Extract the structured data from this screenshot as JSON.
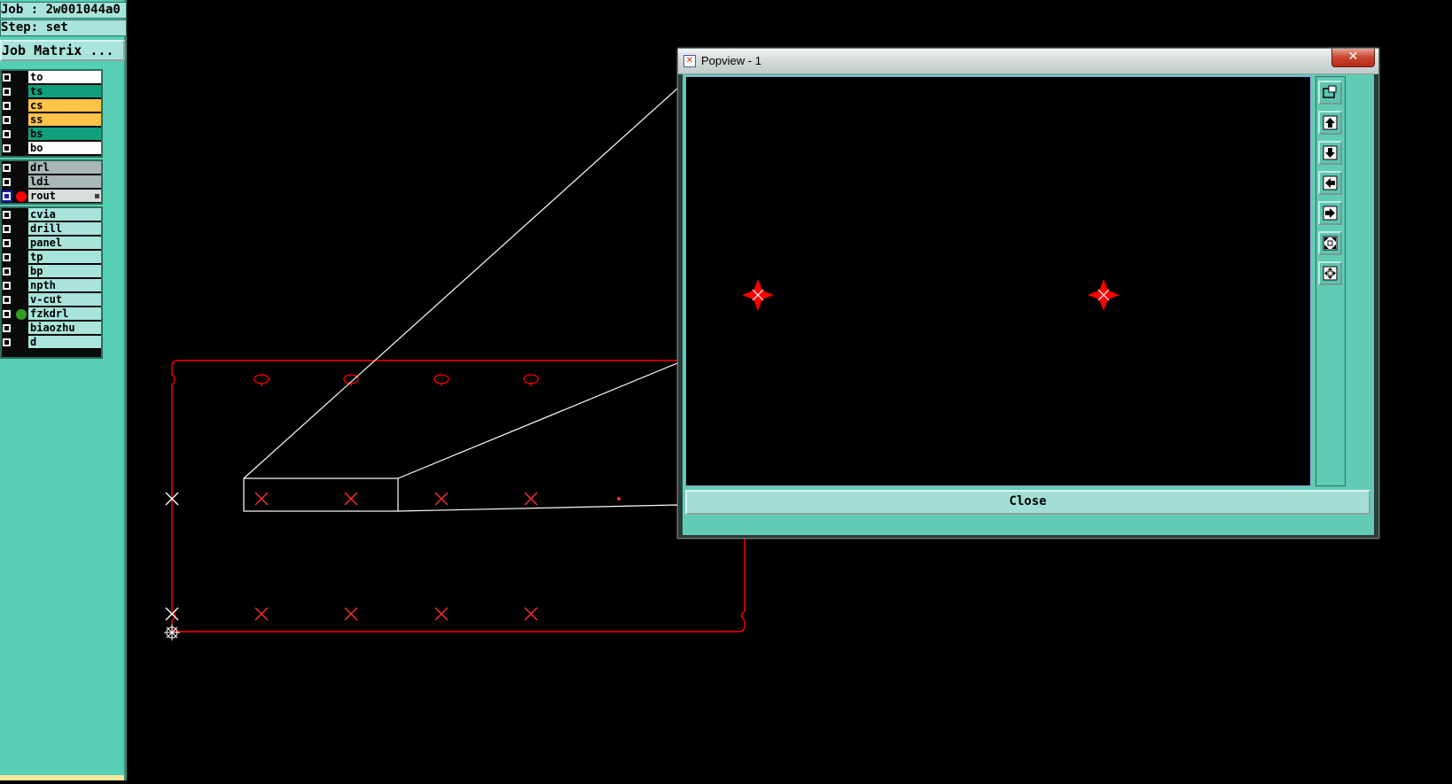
{
  "job": {
    "job_label": "Job : 2w001044a0",
    "step_label": "Step: set",
    "matrix_button": "Job Matrix ..."
  },
  "layers": {
    "group1": [
      {
        "name": "to",
        "color": "#ffffff"
      },
      {
        "name": "ts",
        "color": "#10a07c"
      },
      {
        "name": "cs",
        "color": "#ffc34a"
      },
      {
        "name": "ss",
        "color": "#ffc34a"
      },
      {
        "name": "bs",
        "color": "#10a07c"
      },
      {
        "name": "bo",
        "color": "#ffffff"
      }
    ],
    "group2": [
      {
        "name": "drl",
        "color": "#a9b7b7"
      },
      {
        "name": "ldi",
        "color": "#a9b7b7"
      },
      {
        "name": "rout",
        "color": "#d8dcdc",
        "selected": true,
        "dot": "#ff0000"
      }
    ],
    "group3": [
      {
        "name": "cvia",
        "color": "#a9e4da"
      },
      {
        "name": "drill",
        "color": "#a9e4da"
      },
      {
        "name": "panel",
        "color": "#a9e4da"
      },
      {
        "name": "tp",
        "color": "#a9e4da"
      },
      {
        "name": "bp",
        "color": "#a9e4da"
      },
      {
        "name": "npth",
        "color": "#a9e4da"
      },
      {
        "name": "v-cut",
        "color": "#a9e4da"
      },
      {
        "name": "fzkdrl",
        "color": "#a9e4da",
        "dot": "#30a020"
      },
      {
        "name": "biaozhu",
        "color": "#a9e4da"
      },
      {
        "name": "d",
        "color": "#a9e4da"
      }
    ]
  },
  "popview": {
    "title": "Popview - 1",
    "close_x": "✕",
    "close_button": "Close",
    "tools": [
      "zoom-window-icon",
      "pan-up-icon",
      "pan-down-icon",
      "pan-left-icon",
      "pan-right-icon",
      "zoom-fit-icon",
      "zoom-home-icon"
    ]
  },
  "colors": {
    "panel_bg": "#57cfb5",
    "graphic_bg": "#000000",
    "rout_outline": "#ff0000",
    "zoom_lines": "#ffffff"
  }
}
